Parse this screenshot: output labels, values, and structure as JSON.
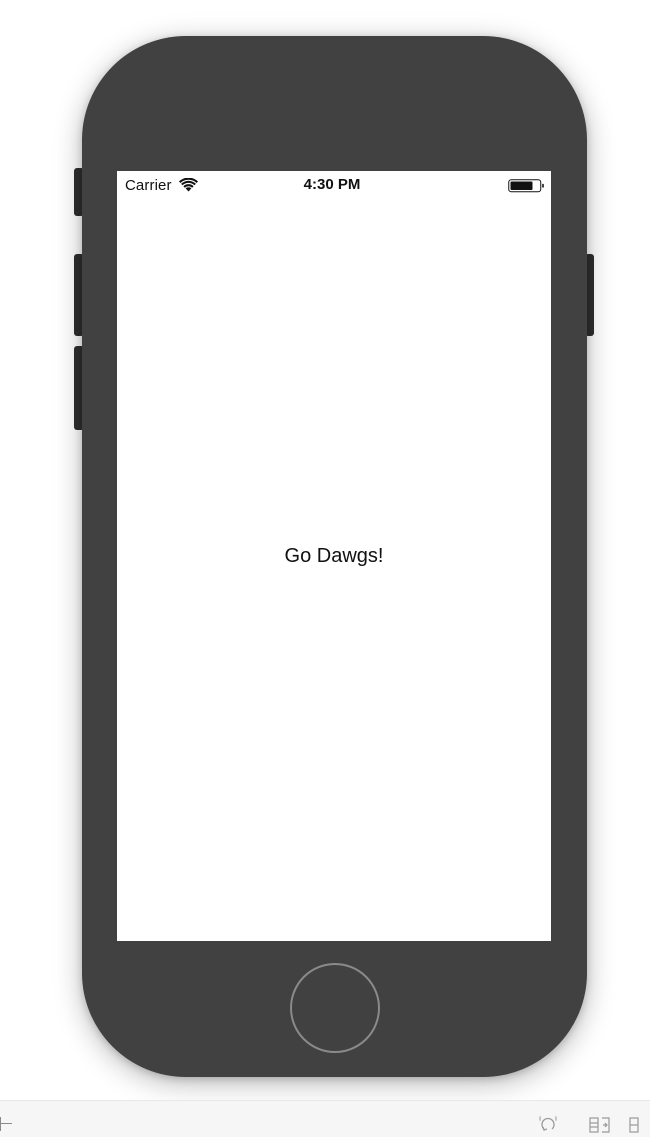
{
  "status_bar": {
    "carrier": "Carrier",
    "time": "4:30 PM",
    "wifi_icon": "wifi-icon",
    "battery_icon": "battery-icon"
  },
  "content": {
    "label": "Go Dawgs!"
  },
  "device": {
    "frame_color": "#414141",
    "home_button_icon": "home-button"
  },
  "toolbar": {
    "icons": [
      "add-constraint-icon",
      "refresh-icon",
      "resolve-layout-icon",
      "embed-icon"
    ]
  }
}
